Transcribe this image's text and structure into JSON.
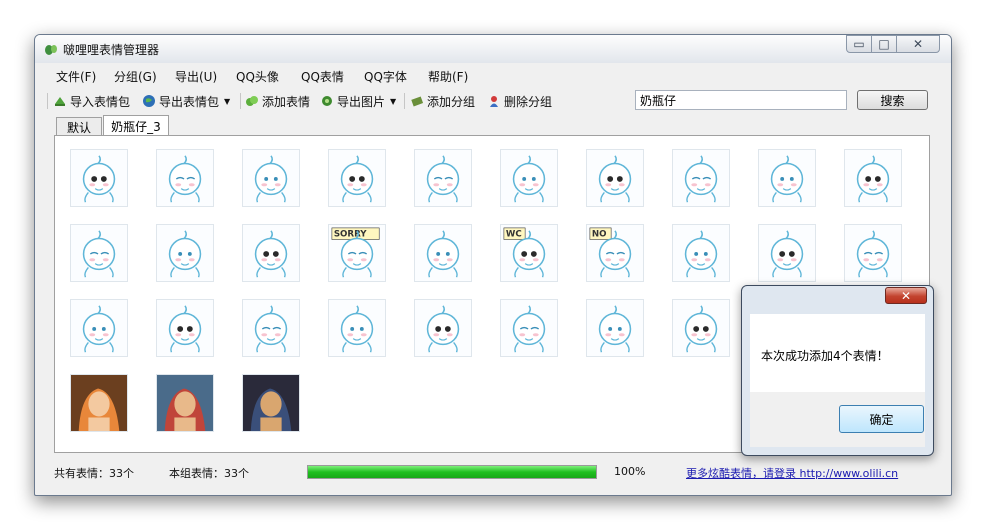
{
  "window": {
    "title": "啵哩哩表情管理器"
  },
  "menu": [
    "文件(F)",
    "分组(G)",
    "导出(U)",
    "QQ头像",
    "QQ表情",
    "QQ字体",
    "帮助(F)"
  ],
  "toolbar": {
    "import_pack": "导入表情包",
    "export_pack": "导出表情包",
    "add_emoticon": "添加表情",
    "export_image": "导出图片",
    "add_group": "添加分组",
    "delete_group": "删除分组"
  },
  "search": {
    "value": "奶瓶仔",
    "button": "搜索"
  },
  "tabs": [
    "默认",
    "奶瓶仔_3"
  ],
  "thumbnails": {
    "count": 33,
    "items": [
      "cartoon",
      "cartoon",
      "cartoon",
      "cartoon",
      "cartoon",
      "cartoon",
      "cartoon",
      "cartoon",
      "cartoon",
      "cartoon",
      "cartoon",
      "cartoon",
      "cartoon",
      "cartoon",
      "cartoon",
      "cartoon",
      "cartoon",
      "cartoon",
      "cartoon",
      "cartoon",
      "cartoon",
      "cartoon",
      "cartoon",
      "cartoon",
      "cartoon",
      "cartoon",
      "cartoon",
      "cartoon",
      "cartoon",
      "cartoon",
      "anime",
      "anime",
      "anime"
    ],
    "captions": {
      "13": "SORRY",
      "15": "WC",
      "16": "NO"
    }
  },
  "status": {
    "total": "共有表情：33个",
    "group": "本组表情：33个",
    "progress_percent": 100,
    "progress_label": "100%",
    "link": "更多炫酷表情，请登录 http://www.olili.cn"
  },
  "dialog": {
    "message": "本次成功添加4个表情！",
    "ok": "确定",
    "close": "✕"
  },
  "colors": {
    "accent_blue": "#3c7fb1",
    "progress_green": "#20c020",
    "link": "#1a1ab0",
    "close_red": "#c3442f"
  }
}
